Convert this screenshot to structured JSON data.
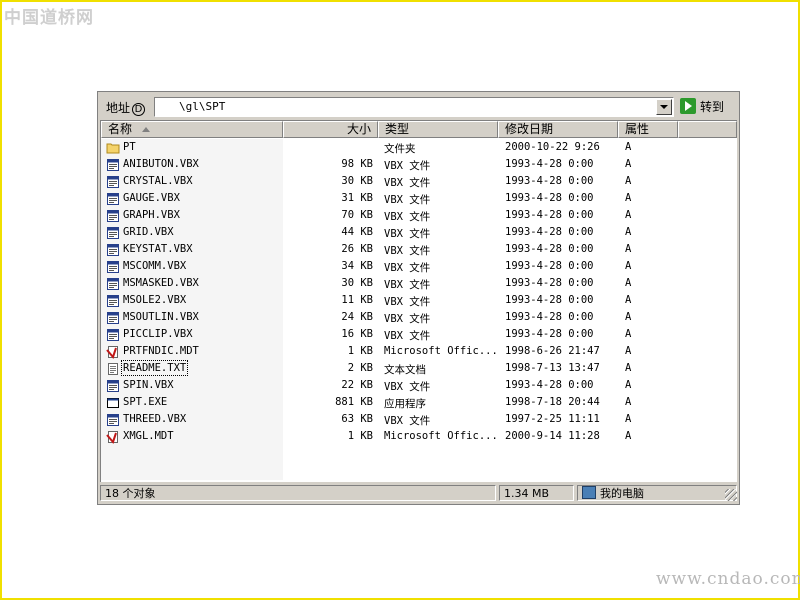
{
  "watermark": {
    "top": "中国道桥网",
    "bottom": "www.cndao.com"
  },
  "address": {
    "label": "地址",
    "hotkey": "D",
    "path": "\\gl\\SPT",
    "go_label": "转到"
  },
  "columns": [
    "名称",
    "大小",
    "类型",
    "修改日期",
    "属性"
  ],
  "files": [
    {
      "name": "PT",
      "size": "",
      "type": "文件夹",
      "date": "2000-10-22 9:26",
      "attr": "A",
      "icon": "folder-icon"
    },
    {
      "name": "ANIBUTON.VBX",
      "size": "98 KB",
      "type": "VBX 文件",
      "date": "1993-4-28 0:00",
      "attr": "A",
      "icon": "vbx-file-icon"
    },
    {
      "name": "CRYSTAL.VBX",
      "size": "30 KB",
      "type": "VBX 文件",
      "date": "1993-4-28 0:00",
      "attr": "A",
      "icon": "vbx-file-icon"
    },
    {
      "name": "GAUGE.VBX",
      "size": "31 KB",
      "type": "VBX 文件",
      "date": "1993-4-28 0:00",
      "attr": "A",
      "icon": "vbx-file-icon"
    },
    {
      "name": "GRAPH.VBX",
      "size": "70 KB",
      "type": "VBX 文件",
      "date": "1993-4-28 0:00",
      "attr": "A",
      "icon": "vbx-file-icon"
    },
    {
      "name": "GRID.VBX",
      "size": "44 KB",
      "type": "VBX 文件",
      "date": "1993-4-28 0:00",
      "attr": "A",
      "icon": "vbx-file-icon"
    },
    {
      "name": "KEYSTAT.VBX",
      "size": "26 KB",
      "type": "VBX 文件",
      "date": "1993-4-28 0:00",
      "attr": "A",
      "icon": "vbx-file-icon"
    },
    {
      "name": "MSCOMM.VBX",
      "size": "34 KB",
      "type": "VBX 文件",
      "date": "1993-4-28 0:00",
      "attr": "A",
      "icon": "vbx-file-icon"
    },
    {
      "name": "MSMASKED.VBX",
      "size": "30 KB",
      "type": "VBX 文件",
      "date": "1993-4-28 0:00",
      "attr": "A",
      "icon": "vbx-file-icon"
    },
    {
      "name": "MSOLE2.VBX",
      "size": "11 KB",
      "type": "VBX 文件",
      "date": "1993-4-28 0:00",
      "attr": "A",
      "icon": "vbx-file-icon"
    },
    {
      "name": "MSOUTLIN.VBX",
      "size": "24 KB",
      "type": "VBX 文件",
      "date": "1993-4-28 0:00",
      "attr": "A",
      "icon": "vbx-file-icon"
    },
    {
      "name": "PICCLIP.VBX",
      "size": "16 KB",
      "type": "VBX 文件",
      "date": "1993-4-28 0:00",
      "attr": "A",
      "icon": "vbx-file-icon"
    },
    {
      "name": "PRTFNDIC.MDT",
      "size": "1 KB",
      "type": "Microsoft Offic...",
      "date": "1998-6-26 21:47",
      "attr": "A",
      "icon": "mdt-file-icon"
    },
    {
      "name": "README.TXT",
      "size": "2 KB",
      "type": "文本文档",
      "date": "1998-7-13 13:47",
      "attr": "A",
      "icon": "text-file-icon"
    },
    {
      "name": "SPIN.VBX",
      "size": "22 KB",
      "type": "VBX 文件",
      "date": "1993-4-28 0:00",
      "attr": "A",
      "icon": "vbx-file-icon"
    },
    {
      "name": "SPT.EXE",
      "size": "881 KB",
      "type": "应用程序",
      "date": "1998-7-18 20:44",
      "attr": "A",
      "icon": "exe-file-icon"
    },
    {
      "name": "THREED.VBX",
      "size": "63 KB",
      "type": "VBX 文件",
      "date": "1997-2-25 11:11",
      "attr": "A",
      "icon": "vbx-file-icon"
    },
    {
      "name": "XMGL.MDT",
      "size": "1 KB",
      "type": "Microsoft Offic...",
      "date": "2000-9-14 11:28",
      "attr": "A",
      "icon": "mdt-file-icon"
    }
  ],
  "status": {
    "count": "18 个对象",
    "size": "1.34 MB",
    "location": "我的电脑"
  },
  "colors": {
    "frame": "#f0e000",
    "chrome": "#d4d0c8",
    "go": "#2d9a2d"
  }
}
